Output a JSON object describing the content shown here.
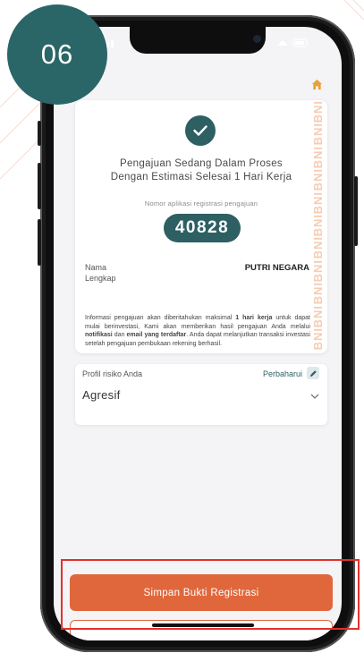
{
  "step_badge": "06",
  "status": {
    "title_line1": "Pengajuan Sedang Dalam Proses",
    "title_line2": "Dengan Estimasi Selesai 1 Hari Kerja",
    "app_number_label": "Nomor aplikasi registrasi pengajuan",
    "app_number": "40828",
    "watermark": "BNI"
  },
  "applicant": {
    "name_label_line1": "Nama",
    "name_label_line2": "Lengkap",
    "name_value": "PUTRI NEGARA"
  },
  "info": {
    "p1": "Informasi pengajuan akan diberitahukan maksimal ",
    "b1": "1 hari kerja",
    "p2": " untuk dapat mulai berinvestasi, Kami akan memberikan hasil pengajuan Anda melalui ",
    "b2": "notifikasi",
    "p3": " dan ",
    "b3": "email yang terdaftar",
    "p4": ". Anda dapat melanjutkan transaksi investasi setelah pengajuan pembukaan rekening berhasil."
  },
  "risk_profile": {
    "label": "Profil risiko Anda",
    "update_label": "Perbaharui",
    "value": "Agresif"
  },
  "buttons": {
    "save_receipt": "Simpan Bukti Registrasi"
  },
  "colors": {
    "brand_teal": "#2d5f63",
    "accent_orange": "#e0673b",
    "highlight_red": "#e4302b",
    "badge_teal": "#2a6667"
  },
  "icons": {
    "home": "home-icon",
    "check": "check-icon",
    "pencil": "pencil-icon",
    "chevron": "chevron-down-icon"
  }
}
